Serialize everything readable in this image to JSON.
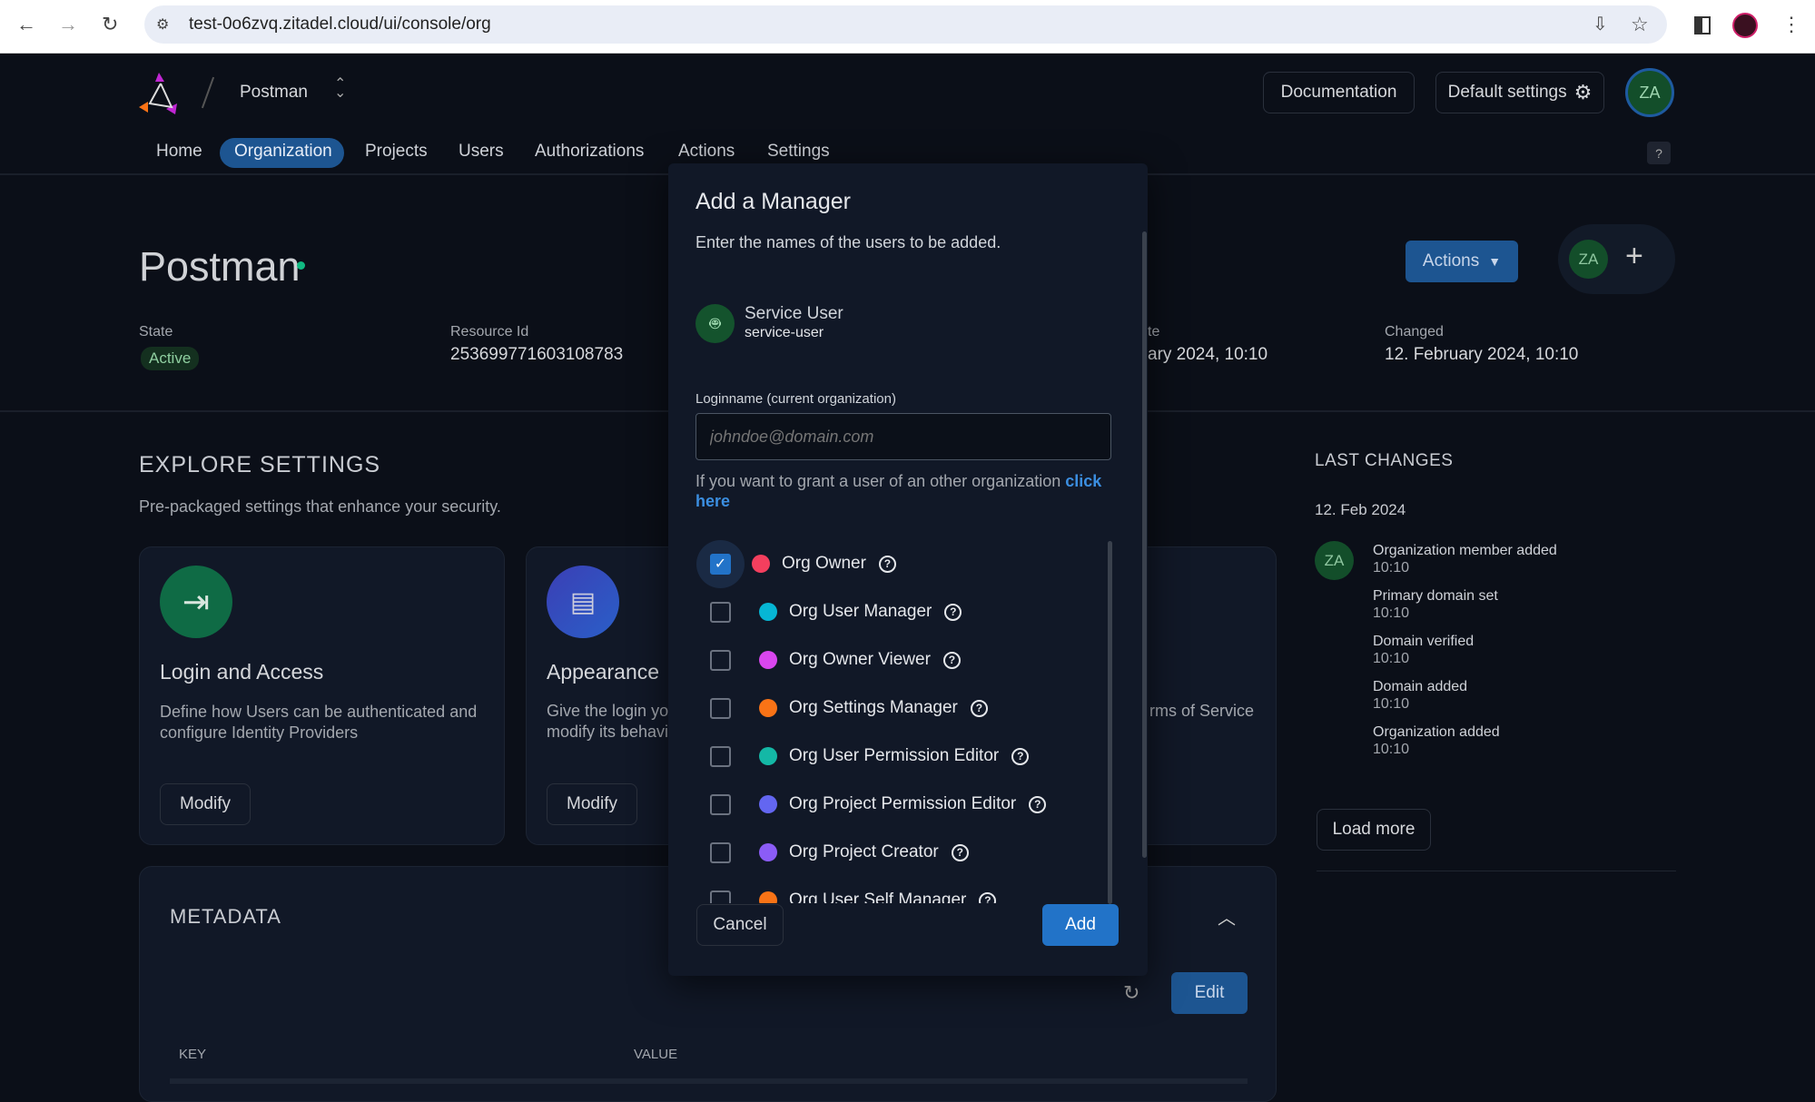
{
  "browser": {
    "url": "test-0o6zvq.zitadel.cloud/ui/console/org"
  },
  "header": {
    "org_name": "Postman",
    "documentation": "Documentation",
    "default_settings": "Default settings",
    "avatar": "ZA",
    "help": "?"
  },
  "nav": {
    "items": [
      "Home",
      "Organization",
      "Projects",
      "Users",
      "Authorizations",
      "Actions",
      "Settings"
    ],
    "active": "Organization"
  },
  "org": {
    "title": "Postman",
    "actions": "Actions",
    "member_avatar": "ZA",
    "state_label": "State",
    "state_value": "Active",
    "resource_label": "Resource Id",
    "resource_value": "253699771603108783",
    "created_label_partial": "te",
    "created_value_partial": "ary 2024, 10:10",
    "changed_label": "Changed",
    "changed_value": "12. February 2024, 10:10"
  },
  "explore": {
    "title": "EXPLORE SETTINGS",
    "subtitle": "Pre-packaged settings that enhance your security.",
    "cards": [
      {
        "title": "Login and Access",
        "desc": "Define how Users can be authenticated and configure Identity Providers",
        "button": "Modify"
      },
      {
        "title": "Appearance",
        "desc_line1": "Give the login yo",
        "desc_line2": "modify its behavi",
        "button": "Modify"
      },
      {
        "desc_partial": "rms of Service"
      }
    ]
  },
  "metadata": {
    "title": "METADATA",
    "edit": "Edit",
    "col_key": "KEY",
    "col_value": "VALUE"
  },
  "last_changes": {
    "title": "LAST CHANGES",
    "date": "12. Feb 2024",
    "avatar": "ZA",
    "items": [
      {
        "t": "Organization member added",
        "s": "10:10"
      },
      {
        "t": "Primary domain set",
        "s": "10:10"
      },
      {
        "t": "Domain verified",
        "s": "10:10"
      },
      {
        "t": "Domain added",
        "s": "10:10"
      },
      {
        "t": "Organization added",
        "s": "10:10"
      }
    ],
    "load_more": "Load more"
  },
  "modal": {
    "title": "Add a Manager",
    "subtitle": "Enter the names of the users to be added.",
    "user": {
      "name": "Service User",
      "login": "service-user"
    },
    "field_label": "Loginname (current organization)",
    "placeholder": "johndoe@domain.com",
    "hint": "If you want to grant a user of an other organization ",
    "hint_link": "click here",
    "roles": [
      {
        "label": "Org Owner",
        "color": "#f43f5e",
        "checked": true
      },
      {
        "label": "Org User Manager",
        "color": "#06b6d4",
        "checked": false
      },
      {
        "label": "Org Owner Viewer",
        "color": "#d946ef",
        "checked": false
      },
      {
        "label": "Org Settings Manager",
        "color": "#f97316",
        "checked": false
      },
      {
        "label": "Org User Permission Editor",
        "color": "#14b8a6",
        "checked": false
      },
      {
        "label": "Org Project Permission Editor",
        "color": "#6366f1",
        "checked": false
      },
      {
        "label": "Org Project Creator",
        "color": "#8b5cf6",
        "checked": false
      },
      {
        "label": "Org User Self Manager",
        "color": "#f97316",
        "checked": false
      }
    ],
    "cancel": "Cancel",
    "add": "Add"
  }
}
